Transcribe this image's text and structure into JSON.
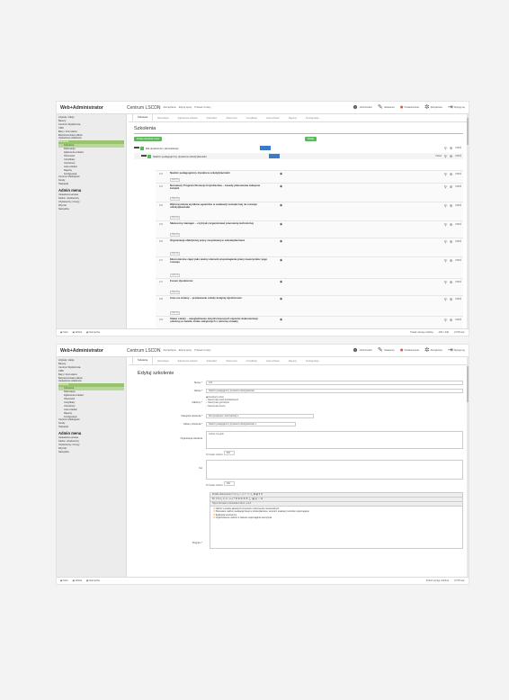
{
  "app": {
    "brand": "Web+Administrator",
    "site": "Centrum LSCDN"
  },
  "header_mini": [
    "Zarządzanie",
    "Edytuj wpisy",
    "Przekaż zmiany"
  ],
  "topnav": [
    "Administrator",
    "Ustawienia",
    "Powiadomienia",
    "Zarządzanie",
    "Wyloguj się"
  ],
  "sidebar": {
    "items": [
      "Artykuły i Akcje",
      "Banery",
      "Centrum Wydarzenia",
      "CMS",
      "Bazy i Formularze",
      "Bezpieczeństwo plików",
      "Ustawienia szablonów",
      "Szkolenia"
    ],
    "subitems": [
      "Szkolenia",
      "Rekrutacja",
      "Zgłoszenia szkoleń",
      "Obecności",
      "Certyfikaty",
      "Uczestnicy",
      "Lista szkoleń",
      "Raporty",
      "Konfiguracja"
    ],
    "after": [
      "Centrum Mailingowe",
      "Sondy",
      "Statystyki"
    ],
    "admin_heading": "Admin menu",
    "admin_items": [
      "Ustawienia serwisu",
      "Kadra i użytkownicy",
      "Użytkownicy i Grupy",
      "Wtyczki",
      "Narzędzia"
    ]
  },
  "tabs": [
    "Szkolenia",
    "Rekrutacja",
    "Zgłoszenia szkoleń",
    "Kalendarz",
    "Obecności",
    "Certyfikaty",
    "Lista szkoleń",
    "Raporty",
    "Konfiguracja"
  ],
  "list": {
    "title": "Szkolenia",
    "add_button": "Dodaj szkolenie nowe",
    "add_button2": "Dodaj",
    "root": "Dla dyrektorów i administracji",
    "category": "Nadzór pedagogiczny dyrektora szkoły/placówki",
    "category_filter": "Pokaż",
    "items": [
      {
        "num": "103",
        "title": "Nadzór pedagogiczny dyrektora szkoły/placówki"
      },
      {
        "num": "104",
        "title": "Narodowy Program Rozwoju Czytelnictwa – zasady planowania zakupów książek"
      },
      {
        "num": "105",
        "title": "Wykorzystanie wyników egzaminu w ewaluacji zewnętrznej na rozwoju szkoły/placówki"
      },
      {
        "num": "106",
        "title": "Skuteczny manager – czyli jak zorganizować pracownię technicznej"
      },
      {
        "num": "106",
        "title": "Organizacja efektywnej pracy zespołowej w szkole/placówce"
      },
      {
        "num": "107",
        "title": "Ekonomiczne zajęć jako ważny element wspomagania pracy nauczyciela i jego rozwoju"
      },
      {
        "num": "107",
        "title": "Forum dyrektorów"
      },
      {
        "num": "108",
        "title": "Czas na zmiany – przekazanie szkoły kolejnej dyrektorowi"
      },
      {
        "num": "109",
        "title": "Statut szkoły – uwzględnienie dotychczasowych zapisów dokumentacji szkolnej w świetle zmian związanych z reformą oświaty"
      }
    ],
    "item_tag": "WIDOK",
    "action_edit": "EDYTUJ",
    "action_del": "USUŃ"
  },
  "edit": {
    "title": "Edytuj szkolenie",
    "fields": [
      {
        "label": "Numer *",
        "value": "103"
      },
      {
        "label": "Nazwa *",
        "value": "Nadzór pedagogiczny dyrektora szkoły/placówki"
      }
    ],
    "odbiorcy_label": "Odbiorcy *",
    "odbiorcy": [
      "Dyrektorzy szkół",
      "Nauczyciele szkół podstawowych",
      "Nauczyciele gimnazjów",
      "Nauczyciele liceów"
    ],
    "kategoria_label": "Kategoria szkolenia *",
    "kategoria": "Dla dyrektorów i administracji",
    "glowny_label": "Główny szkolenia *",
    "glowny": "Nadzór pedagogiczny dyrektora szkoły/placówki",
    "org_label": "Organizacja szkolenia",
    "org_text": "Liczba: 12 godz.",
    "limit_label": "Pozostało znaków:",
    "limit1": "200",
    "cel_label": "Cel",
    "limit2": "200",
    "program_label": "Program *",
    "rte_toolbar1": "Źródło dokumentu  ☐  ⎘  ⎗  ✂  ⎙  ↶  ↷  🔍  ⇄  ▦  ¶  Ω",
    "rte_toolbar2": "B  I  U  S  x₂  x²  ⊘  ⁞  ≡  ≡  ❝  ≣  ≣  ≣  ≣  ⚑  ⚓  ▣  ▤  ☺  ⊞",
    "rte_toolbar3": "Styl  ▾  Format  ▾  Czcionka  ▾  Roz.  ▾  A  A",
    "program": [
      "Nadzór w świetle aktualnych przepisów i dokumentów ministerialnych",
      "Planowanie nadzoru pedagogicznego w szkole/placówce, wnioski z ewaluacji, kontrola i wspomaganie",
      "Ewaluacja wewnętrzna",
      "Organizowanie nadzoru w zakresie wspomagania nauczycieli"
    ]
  },
  "footer": {
    "items": [
      "Start",
      "Widok",
      "Narzędzia"
    ],
    "right1": "Pokaż wersję mobilną",
    "right2": "200 z 240",
    "right3": "0.078 sek."
  }
}
